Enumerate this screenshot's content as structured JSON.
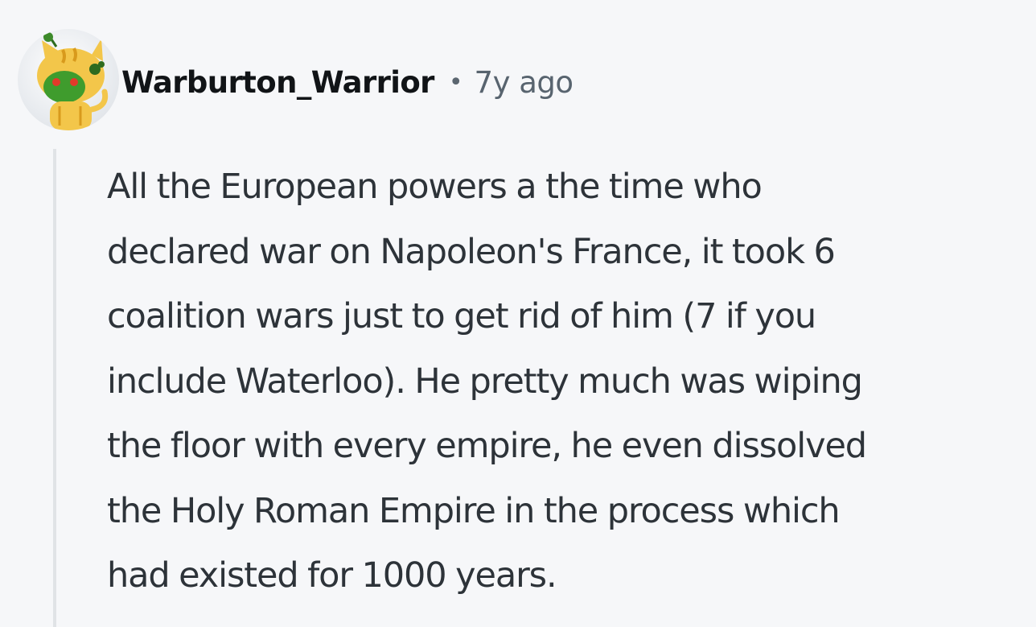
{
  "comment": {
    "author": {
      "username": "Warburton_Warrior",
      "avatar_icon": "snoo-avatar-icon"
    },
    "separator": "•",
    "timestamp": "7y ago",
    "body_lines": [
      "All the European powers a the time who",
      "declared war on Napoleon's France, it took 6",
      "coalition wars just to get rid of him (7 if you",
      "include Waterloo). He pretty much was wiping",
      "the floor with every empire, he even dissolved",
      "the Holy Roman Empire in the process which",
      "had existed for 1000 years."
    ]
  },
  "colors": {
    "background": "#f6f7f9",
    "username": "#111417",
    "meta": "#58646f",
    "body": "#2d3339",
    "thread_line": "#e0e3e6"
  }
}
